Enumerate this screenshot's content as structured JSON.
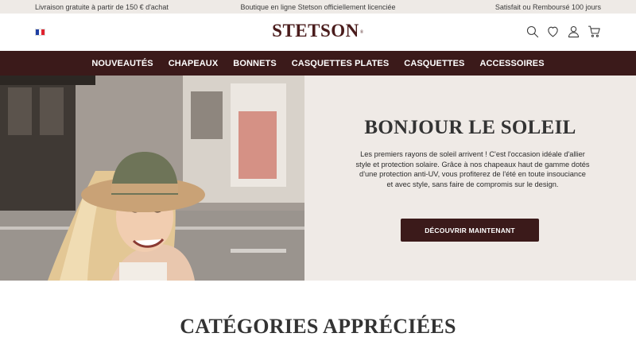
{
  "topbar": {
    "left": "Livraison gratuite à partir de 150 € d'achat",
    "center": "Boutique en ligne Stetson officiellement licenciée",
    "right": "Satisfait ou Remboursé 100 jours"
  },
  "header": {
    "logo": "STETSON",
    "logo_mark": "®",
    "flag_colors": [
      "#1f3fa3",
      "#ffffff",
      "#e0232f"
    ],
    "icons": [
      "search-icon",
      "heart-icon",
      "user-icon",
      "cart-icon"
    ]
  },
  "nav": {
    "items": [
      {
        "label": "NOUVEAUTÉS"
      },
      {
        "label": "CHAPEAUX"
      },
      {
        "label": "BONNETS"
      },
      {
        "label": "CASQUETTES PLATES"
      },
      {
        "label": "CASQUETTES"
      },
      {
        "label": "ACCESSOIRES"
      }
    ]
  },
  "hero": {
    "title": "BONJOUR LE SOLEIL",
    "text": "Les premiers rayons de soleil arrivent ! C'est l'occasion idéale d'allier style et protection solaire. Grâce à nos chapeaux haut de gamme dotés d'une protection anti-UV, vous profiterez de l'été en toute insouciance et avec style, sans faire de compromis sur le design.",
    "cta": "DÉCOUVRIR MAINTENANT"
  },
  "section": {
    "title": "CATÉGORIES APPRÉCIÉES"
  },
  "colors": {
    "brand": "#3b1a1a",
    "topbar_bg": "#eeeae6",
    "hero_panel_bg": "#efeae6"
  }
}
